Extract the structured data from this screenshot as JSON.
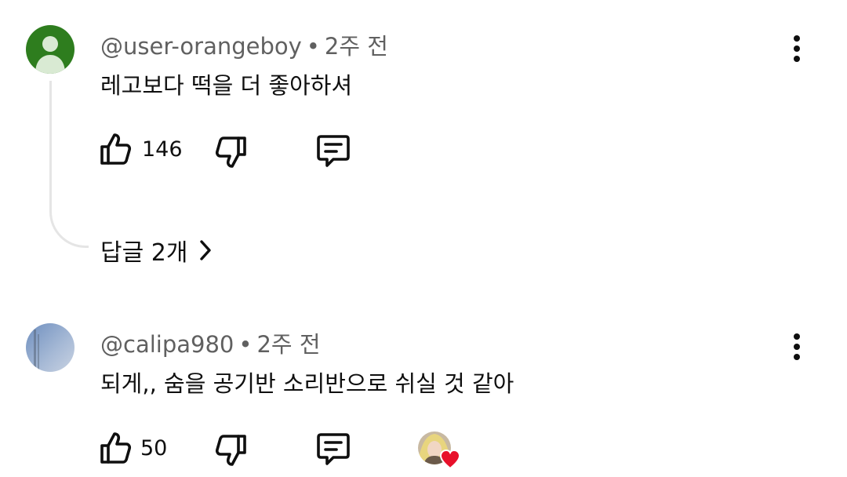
{
  "comments": [
    {
      "author": "@user-orangeboy",
      "time": "2주 전",
      "separator": "•",
      "text": "레고보다 떡을 더 좋아하셔",
      "likes": "146",
      "replies_label": "답글 2개",
      "avatar_color": "#2e7d1e"
    },
    {
      "author": "@calipa980",
      "time": "2주 전",
      "separator": "•",
      "text": "되게,, 숨을 공기반 소리반으로 쉬실 것 같아",
      "likes": "50",
      "avatar_color": "#8fa5c8",
      "creator_heart_color": "#e8102a"
    }
  ],
  "icons": [
    "like-icon",
    "dislike-icon",
    "reply-icon",
    "more-vert-icon",
    "chevron-right-icon",
    "creator-heart-icon"
  ]
}
